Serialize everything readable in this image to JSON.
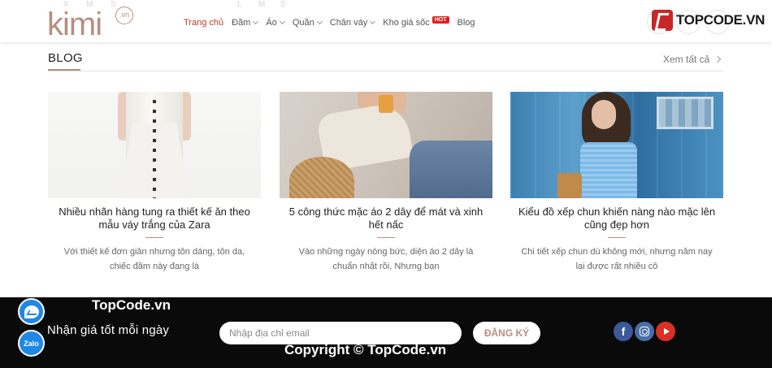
{
  "header": {
    "logo_text": "kimi",
    "logo_badge": ".vn",
    "ghost_marks": [
      "X",
      "M",
      "S",
      "L",
      "M",
      "S"
    ],
    "nav": [
      {
        "label": "Trang chủ",
        "active": true,
        "has_dropdown": false
      },
      {
        "label": "Đầm",
        "active": false,
        "has_dropdown": true
      },
      {
        "label": "Áo",
        "active": false,
        "has_dropdown": true
      },
      {
        "label": "Quần",
        "active": false,
        "has_dropdown": true
      },
      {
        "label": "Chân váy",
        "active": false,
        "has_dropdown": true
      },
      {
        "label": "Kho giá sốc",
        "active": false,
        "has_dropdown": false,
        "badge": "HOT"
      },
      {
        "label": "Blog",
        "active": false,
        "has_dropdown": false
      }
    ],
    "topcode_logo": "TOPCODE.VN"
  },
  "blog": {
    "title": "BLOG",
    "see_all": "Xem tất cả",
    "posts": [
      {
        "title": "Nhiều nhãn hàng tung ra thiết kế ăn theo mẫu váy trắng của Zara",
        "excerpt": "Với thiết kế đơn giản nhưng tôn dáng, tôn da, chiếc đầm này đang là"
      },
      {
        "title": "5 công thức mặc áo 2 dây để mát và xinh hết nấc",
        "excerpt": "Vào những ngày nóng bức, diện áo 2 dây là chuẩn nhất rồi. Nhưng bạn"
      },
      {
        "title": "Kiểu đồ xếp chun khiến nàng nào mặc lên cũng đẹp hơn",
        "excerpt": "Chi tiết xếp chun dù không mới, nhưng năm nay lại được rất nhiều cô"
      }
    ]
  },
  "footer": {
    "newsletter_label": "Nhận giá tốt mỗi ngày",
    "email_placeholder": "Nhập địa chỉ email",
    "subscribe_label": "ĐĂNG KÝ",
    "zalo_label": "Zalo",
    "fb_glyph": "f",
    "watermark_top": "TopCode.vn",
    "watermark_bottom": "Copyright © TopCode.vn"
  },
  "colors": {
    "accent": "#b88d7f",
    "nav_active": "#c0392b",
    "footer_bg": "#0a0a0a",
    "hot_badge": "#e02020"
  },
  "icons": [
    "chevron-down-icon",
    "chevron-right-icon",
    "facebook-icon",
    "instagram-icon",
    "youtube-icon",
    "messenger-icon",
    "zalo-icon"
  ]
}
